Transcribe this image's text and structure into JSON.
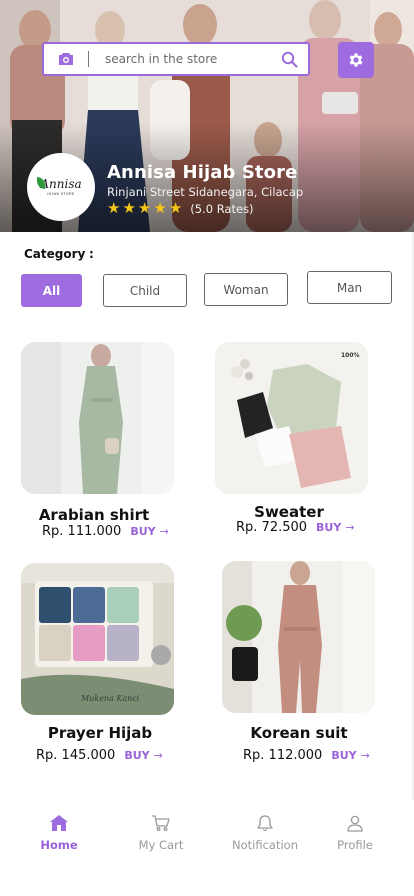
{
  "header": {
    "search_placeholder": "search in the store",
    "store_name": "Annisa Hijab Store",
    "store_address": "Rinjani Street Sidanegara, Cilacap",
    "rating_text": "(5.0 Rates)",
    "rating_stars": 5,
    "logo_word": "Annisa",
    "logo_sub": "HIJAB STORE"
  },
  "category": {
    "title": "Category",
    "colon": ":",
    "chips": [
      {
        "label": "All",
        "active": true
      },
      {
        "label": "Child",
        "active": false
      },
      {
        "label": "Woman",
        "active": false
      },
      {
        "label": "Man",
        "active": false
      }
    ]
  },
  "products": [
    {
      "name": "Arabian shirt",
      "price": "Rp. 111.000",
      "buy": "BUY"
    },
    {
      "name": "Sweater",
      "price": "Rp. 72.500",
      "buy": "BUY"
    },
    {
      "name": "Prayer Hijab",
      "price": "Rp. 145.000",
      "buy": "BUY"
    },
    {
      "name": "Korean suit",
      "price": "Rp. 112.000",
      "buy": "BUY"
    }
  ],
  "product_photo_text": {
    "sweater_tag": "100%",
    "hijab_caption": "Mukena Kanci"
  },
  "nav": [
    {
      "label": "Home",
      "icon": "home-icon",
      "active": true
    },
    {
      "label": "My Cart",
      "icon": "cart-icon",
      "active": false
    },
    {
      "label": "Notification",
      "icon": "bell-icon",
      "active": false
    },
    {
      "label": "Profile",
      "icon": "user-icon",
      "active": false
    }
  ],
  "colors": {
    "accent": "#9f6ce0",
    "accent_text": "#9a62d8",
    "star": "#f5c518",
    "nav_inactive": "#9a9a9a"
  }
}
